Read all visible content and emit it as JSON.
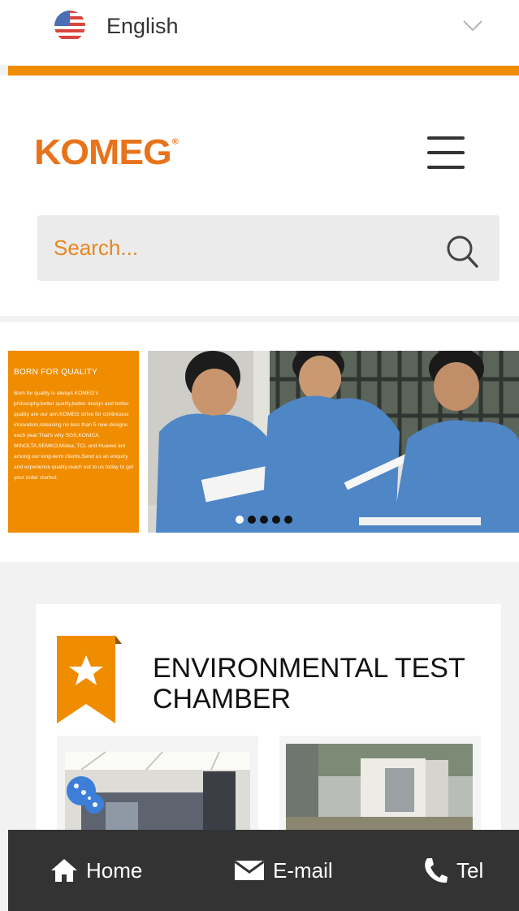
{
  "language": {
    "label": "English",
    "flag_icon": "us-flag-icon",
    "chevron_icon": "chevron-down-icon"
  },
  "brand": {
    "logo_text": "KOMEG",
    "logo_mark": "®",
    "accent_color": "#f08c00",
    "logo_color": "#e8731a"
  },
  "search": {
    "placeholder": "Search...",
    "value": ""
  },
  "banner": {
    "heading": "BORN FOR QUALITY",
    "text": "Born for quality is always KOMEG's philosophy,better quality,better design and better quality are our aim.KOMEG strive for continuous innovation,releasing no less than 5 new designs each year.That's why SGS,KONICA MINOLTA,SEMKO,Midea, TCL and Huawei are among our long-term clients.Send us an enquiry and experience quality,reach out to us today to get your order started.",
    "slides": 5,
    "active_slide": 1
  },
  "section": {
    "title": "ENVIRONMENTAL TEST CHAMBER",
    "ribbon_icon": "star-ribbon-icon"
  },
  "bottom_nav": [
    {
      "label": "Home",
      "icon": "home-icon"
    },
    {
      "label": "E-mail",
      "icon": "mail-icon"
    },
    {
      "label": "Tel",
      "icon": "phone-icon"
    }
  ]
}
